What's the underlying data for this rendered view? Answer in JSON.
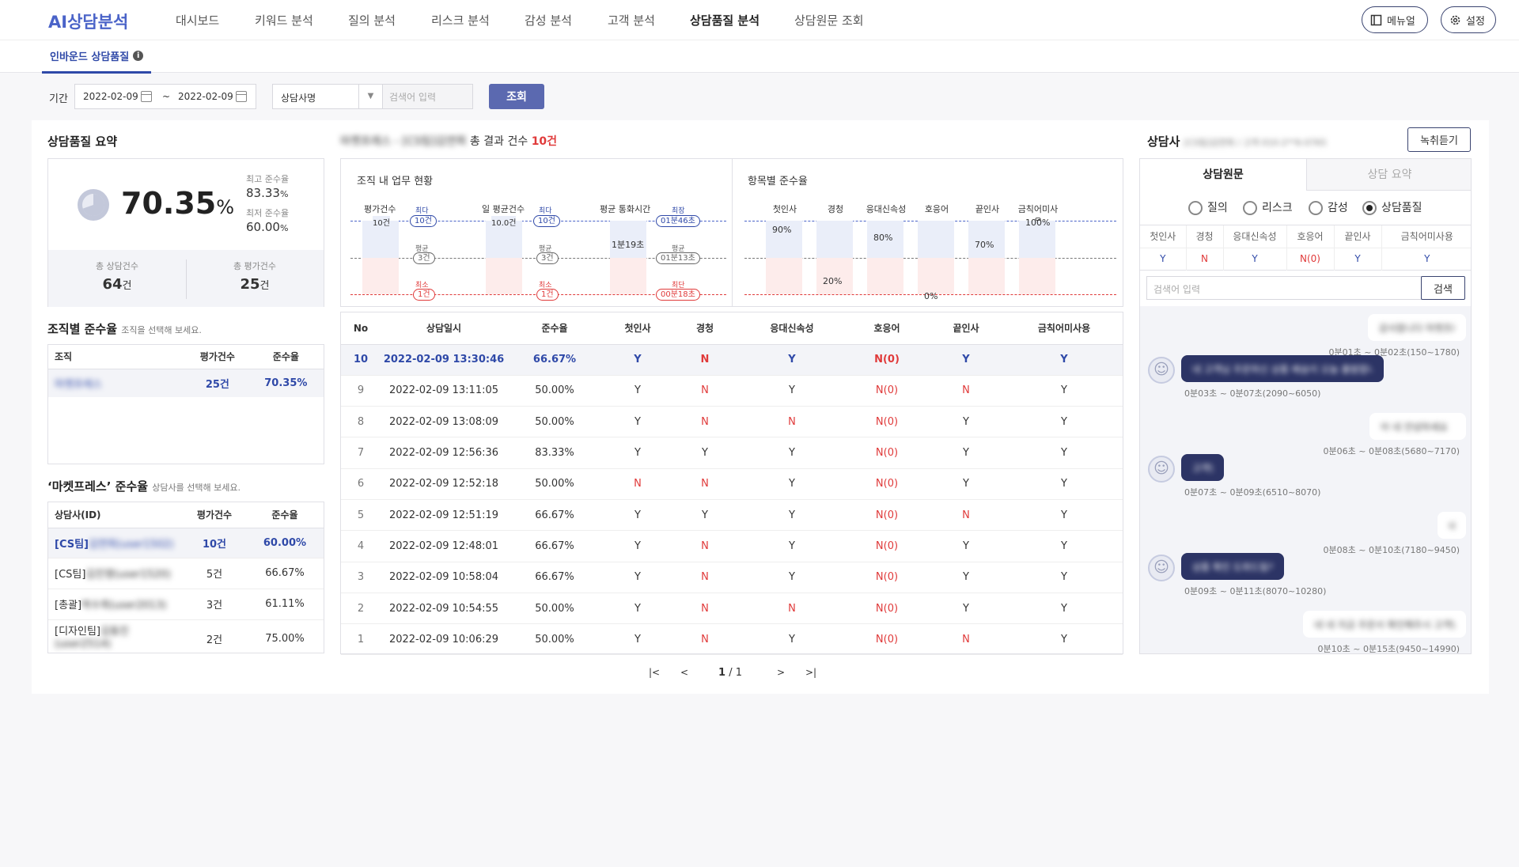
{
  "app": {
    "logo": "AI상담분석"
  },
  "nav": [
    "대시보드",
    "키워드 분석",
    "질의 분석",
    "리스크 분석",
    "감성 분석",
    "고객 분석",
    "상담품질 분석",
    "상담원문 조회"
  ],
  "topbar": {
    "manual": "메뉴얼",
    "settings": "설정"
  },
  "subtab": "인바운드 상담품질",
  "filter": {
    "period_label": "기간",
    "start": "2022-02-09",
    "tilde": "~",
    "end": "2022-02-09",
    "select": "상담사명",
    "search_placeholder": "검색어 입력",
    "button": "조회"
  },
  "summary": {
    "title": "상담품질 요약",
    "rate": "70.35",
    "pct": "%",
    "max_label": "최고 준수율",
    "max": "83.33",
    "min_label": "최저 준수율",
    "min": "60.00",
    "total_label": "총 상담건수",
    "total": "64",
    "total_unit": "건",
    "eval_label": "총 평가건수",
    "eval": "25",
    "eval_unit": "건"
  },
  "org": {
    "title": "조직별 준수율",
    "hint": "조직을 선택해 보세요.",
    "cols": [
      "조직",
      "평가건수",
      "준수율"
    ],
    "rows": [
      {
        "name": "마켓프레스",
        "count": "25건",
        "rate": "70.35%"
      }
    ]
  },
  "agents": {
    "title": "‘마켓프레스’ 준수율",
    "hint": "상담사를 선택해 보세요.",
    "cols": [
      "상담사(ID)",
      "평가건수",
      "준수율"
    ],
    "rows": [
      {
        "team": "[CS팀]",
        "name": "김연희(user1502)",
        "count": "10건",
        "rate": "60.00%"
      },
      {
        "team": "[CS팀]",
        "name": "김진영(user1520)",
        "count": "5건",
        "rate": "66.67%"
      },
      {
        "team": "[총괄]",
        "name": "박수희(user2013)",
        "count": "3건",
        "rate": "61.11%"
      },
      {
        "team": "[디자인팀]",
        "name": "김동진",
        "extra": "(user2514)",
        "count": "2건",
        "rate": "75.00%"
      }
    ]
  },
  "results": {
    "prefix": "마켓프레스 - [CS팀]김연희",
    "label": "총 결과 건수",
    "count": "10건"
  },
  "work": {
    "title": "조직 내 업무 현황",
    "groups": [
      {
        "label": "평가건수",
        "value": "10건",
        "top_tag": "최다",
        "top": "10건",
        "avg_tag": "평균",
        "avg": "3건",
        "low_tag": "최소",
        "low": "1건"
      },
      {
        "label": "일 평균건수",
        "value": "10.0건",
        "top_tag": "최다",
        "top": "10건",
        "avg_tag": "평균",
        "avg": "3건",
        "low_tag": "최소",
        "low": "1건"
      },
      {
        "label": "평균 통화시간",
        "value": "1분19초",
        "top_tag": "최장",
        "top": "01분46초",
        "avg_tag": "평균",
        "avg": "01분13초",
        "low_tag": "최단",
        "low": "00분18초"
      }
    ]
  },
  "items": {
    "title": "항목별 준수율",
    "cols": [
      {
        "label": "첫인사",
        "value": "90%",
        "pct": 90
      },
      {
        "label": "경청",
        "value": "20%",
        "pct": 20
      },
      {
        "label": "응대신속성",
        "value": "80%",
        "pct": 80
      },
      {
        "label": "호응어",
        "value": "0%",
        "pct": 0
      },
      {
        "label": "끝인사",
        "value": "70%",
        "pct": 70
      },
      {
        "label": "금칙어미사용",
        "value": "100%",
        "pct": 100
      }
    ]
  },
  "table": {
    "cols": [
      "No",
      "상담일시",
      "준수율",
      "첫인사",
      "경청",
      "응대신속성",
      "호응어",
      "끝인사",
      "금칙어미사용"
    ],
    "rows": [
      [
        "10",
        "2022-02-09 13:30:46",
        "66.67%",
        "Y",
        "N",
        "Y",
        "N(0)",
        "Y",
        "Y"
      ],
      [
        "9",
        "2022-02-09 13:11:05",
        "50.00%",
        "Y",
        "N",
        "Y",
        "N(0)",
        "N",
        "Y"
      ],
      [
        "8",
        "2022-02-09 13:08:09",
        "50.00%",
        "Y",
        "N",
        "N",
        "N(0)",
        "Y",
        "Y"
      ],
      [
        "7",
        "2022-02-09 12:56:36",
        "83.33%",
        "Y",
        "Y",
        "Y",
        "N(0)",
        "Y",
        "Y"
      ],
      [
        "6",
        "2022-02-09 12:52:18",
        "50.00%",
        "N",
        "N",
        "Y",
        "N(0)",
        "Y",
        "Y"
      ],
      [
        "5",
        "2022-02-09 12:51:19",
        "66.67%",
        "Y",
        "Y",
        "Y",
        "N(0)",
        "N",
        "Y"
      ],
      [
        "4",
        "2022-02-09 12:48:01",
        "66.67%",
        "Y",
        "N",
        "Y",
        "N(0)",
        "Y",
        "Y"
      ],
      [
        "3",
        "2022-02-09 10:58:04",
        "66.67%",
        "Y",
        "N",
        "Y",
        "N(0)",
        "Y",
        "Y"
      ],
      [
        "2",
        "2022-02-09 10:54:55",
        "50.00%",
        "Y",
        "N",
        "N",
        "N(0)",
        "Y",
        "Y"
      ],
      [
        "1",
        "2022-02-09 10:06:29",
        "50.00%",
        "Y",
        "N",
        "Y",
        "N(0)",
        "N",
        "Y"
      ]
    ]
  },
  "pager": {
    "current": "1",
    "sep": "/",
    "total": "1"
  },
  "right": {
    "title": "상담사",
    "agent": "[CS팀]김연희 / 고객 010-2**6-0765",
    "listen": "녹취듣기",
    "tabs": [
      "상담원문",
      "상담 요약"
    ],
    "radios": [
      "질의",
      "리스크",
      "감성",
      "상담품질"
    ],
    "cols": [
      "첫인사",
      "경청",
      "응대신속성",
      "호응어",
      "끝인사",
      "금칙어미사용"
    ],
    "vals": [
      "Y",
      "N",
      "Y",
      "N(0)",
      "Y",
      "Y"
    ],
    "search_placeholder": "검색어 입력",
    "search_btn": "검색",
    "chat": [
      {
        "side": "R",
        "text": "감사합니다 마켓프레스",
        "time": "0분01초 ~ 0분02초(150~1780)"
      },
      {
        "side": "L",
        "text": "네 고객님 주문하신 상품 배송이 오늘 출발합니다",
        "time": "0분03초 ~ 0분07초(2090~6050)"
      },
      {
        "side": "R",
        "text": "아 네 안녕하세요",
        "time": "0분06초 ~ 0분08초(5680~7170)"
      },
      {
        "side": "L",
        "text": "고객님",
        "time": "0분07초 ~ 0분09초(6510~8070)"
      },
      {
        "side": "R",
        "text": "네",
        "time": "0분08초 ~ 0분10초(7180~9450)"
      },
      {
        "side": "L",
        "text": "상품 확인 도와드릴게요",
        "time": "0분09초 ~ 0분11초(8070~10280)"
      },
      {
        "side": "R",
        "text": "네 네 지금 주문서 확인해주시 고객님",
        "time": "0분10초 ~ 0분15초(9450~14990)"
      }
    ]
  }
}
